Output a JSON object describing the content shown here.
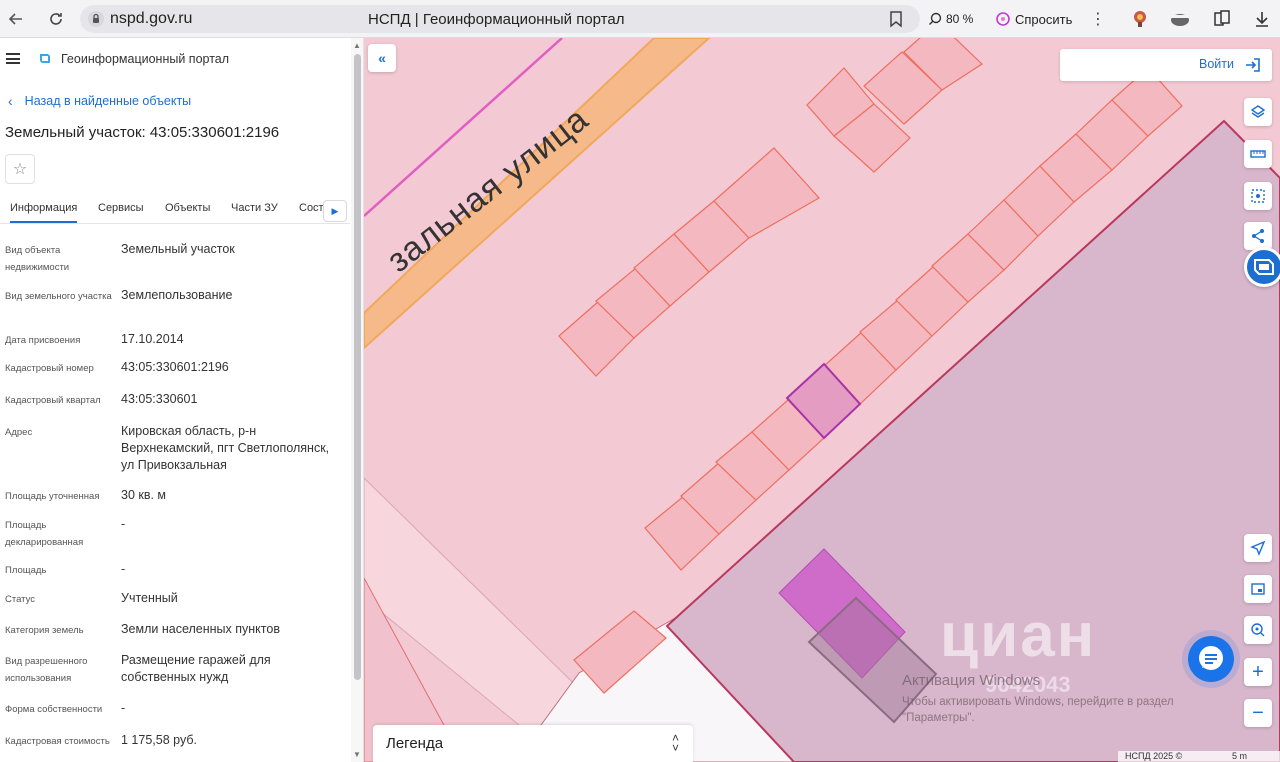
{
  "browser": {
    "url": "nspd.gov.ru",
    "page_title": "НСПД | Геоинформационный портал",
    "zoom": "80 %",
    "ask_label": "Спросить"
  },
  "panel": {
    "portal_title": "Геоинформационный портал",
    "back_link": "Назад в найденные объекты",
    "object_title": "Земельный участок: 43:05:330601:2196",
    "tabs": [
      {
        "label": "Информация"
      },
      {
        "label": "Сервисы"
      },
      {
        "label": "Объекты"
      },
      {
        "label": "Части ЗУ"
      },
      {
        "label": "Сост"
      }
    ],
    "props": [
      {
        "label": "Вид объекта недвижимости",
        "value": "Земельный участок"
      },
      {
        "label": "Вид земельного участка",
        "value": "Землепользование"
      },
      {
        "label": "Дата присвоения",
        "value": "17.10.2014"
      },
      {
        "label": "Кадастровый номер",
        "value": "43:05:330601:2196"
      },
      {
        "label": "Кадастровый квартал",
        "value": "43:05:330601"
      },
      {
        "label": "Адрес",
        "value": "Кировская область, р-н Верхнекамский, пгт Светлополянск, ул Привокзальная"
      },
      {
        "label": "Площадь уточненная",
        "value": "30 кв. м"
      },
      {
        "label": "Площадь декларированная",
        "value": "-"
      },
      {
        "label": "Площадь",
        "value": "-"
      },
      {
        "label": "Статус",
        "value": "Учтенный"
      },
      {
        "label": "Категория земель",
        "value": "Земли населенных пунктов"
      },
      {
        "label": "Вид разрешенного использования",
        "value": "Размещение гаражей для собственных нужд"
      },
      {
        "label": "Форма собственности",
        "value": "-"
      },
      {
        "label": "Кадастровая стоимость",
        "value": "1 175,58 руб."
      }
    ]
  },
  "map": {
    "login_label": "Войти",
    "street_label": "зальная улица",
    "legend_label": "Легенда",
    "watermark": "циан",
    "watermark_phone": "9642043",
    "windows_activation_title": "Активация Windows",
    "windows_activation_text": "Чтобы активировать Windows, перейдите в раздел \"Параметры\".",
    "copyright": "НСПД 2025 ©",
    "scale_label": "5 m",
    "colors": {
      "background": "#f3c9d3",
      "road": "#f6b98a",
      "selected_parcel": "#e59cc3",
      "building": "#cf6bc8",
      "accent": "#1c6fd1"
    }
  }
}
